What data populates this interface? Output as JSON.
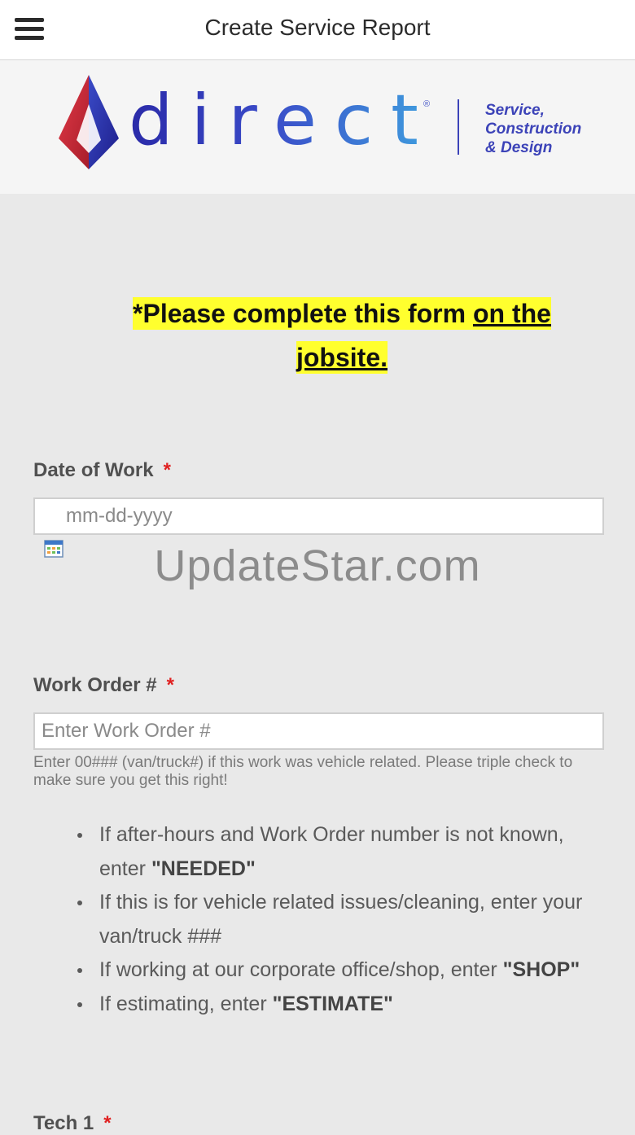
{
  "header": {
    "title": "Create Service Report",
    "menu_icon": "hamburger-menu-icon"
  },
  "logo": {
    "wordmark": "direct",
    "registered": "®",
    "tagline_line1": "Service,",
    "tagline_line2": "Construction",
    "tagline_line3": "& Design",
    "colors": {
      "red": "#d42a3a",
      "blue": "#2a2aa8",
      "light_blue": "#3fa0df"
    }
  },
  "notice": {
    "text_plain": "*Please complete this form ",
    "text_underlined": "on the",
    "text_underlined_2": "jobsite.",
    "highlight_color": "#ffff2e"
  },
  "date_field": {
    "label": "Date of Work",
    "required_mark": "*",
    "placeholder": "mm-dd-yyyy",
    "icon": "calendar-icon"
  },
  "watermark": "UpdateStar.com",
  "work_order_field": {
    "label": "Work Order #",
    "required_mark": "*",
    "placeholder": "Enter Work Order #",
    "helper": "Enter 00### (van/truck#) if this work was vehicle related. Please triple check to make sure you get this right!"
  },
  "instructions": [
    {
      "text": "If after-hours and Work Order number is not known, enter ",
      "bold": "\"NEEDED\""
    },
    {
      "text": "If this is for vehicle related issues/cleaning, enter your van/truck ###",
      "bold": ""
    },
    {
      "text": "If working at our corporate office/shop, enter ",
      "bold": "\"SHOP\""
    },
    {
      "text": "If estimating, enter ",
      "bold": "\"ESTIMATE\""
    }
  ],
  "tech1_field": {
    "label": "Tech 1",
    "required_mark": "*"
  }
}
